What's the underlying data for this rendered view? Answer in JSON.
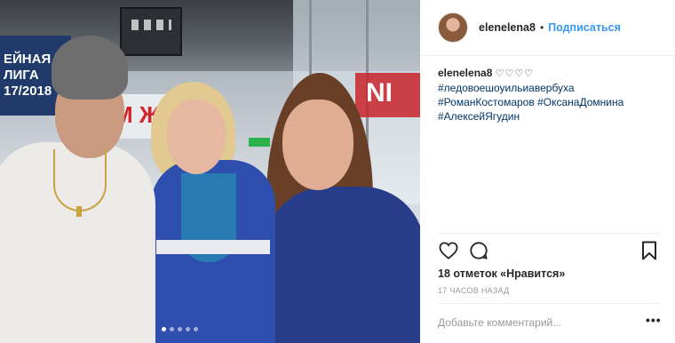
{
  "post": {
    "photo_dots": [
      true,
      false,
      false,
      false,
      false
    ],
    "photo_signs": {
      "league_line1": "ЕЙНАЯ ЛИГА",
      "league_line2": "17/2018",
      "banner": "М Ж",
      "red_sign": "NI"
    }
  },
  "header": {
    "username": "elenelena8",
    "separator": "•",
    "follow_label": "Подписаться"
  },
  "caption": {
    "username": "elenelena8",
    "hearts": "♡♡♡♡",
    "hashtags": [
      "#ледовоешоуильиавербуха",
      "#РоманКостомаров",
      "#ОксанаДомнина",
      "#АлексейЯгудин"
    ]
  },
  "actions": {
    "like_icon": "heart-icon",
    "comment_icon": "comment-bubble-icon",
    "save_icon": "bookmark-icon"
  },
  "likes_text": "18 отметок «Нравится»",
  "timestamp": "17 часов назад",
  "comment": {
    "placeholder": "Добавьте комментарий...",
    "more_label": "•••"
  }
}
